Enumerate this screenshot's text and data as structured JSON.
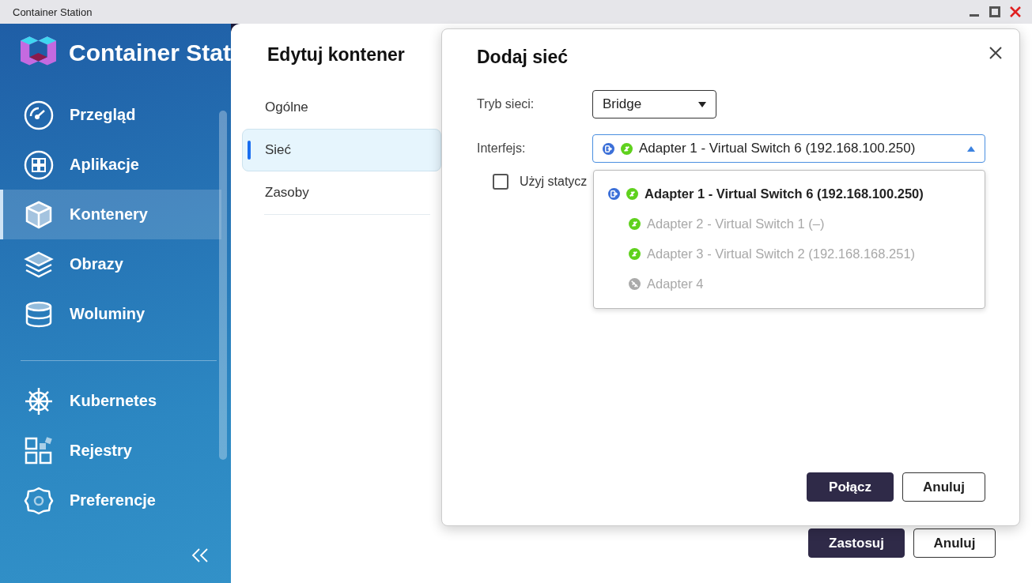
{
  "window": {
    "title": "Container Station"
  },
  "sidebar": {
    "title": "Container Stat",
    "groups": [
      [
        {
          "label": "Przegląd",
          "selected": false
        },
        {
          "label": "Aplikacje",
          "selected": false
        },
        {
          "label": "Kontenery",
          "selected": true
        },
        {
          "label": "Obrazy",
          "selected": false
        },
        {
          "label": "Woluminy",
          "selected": false
        }
      ],
      [
        {
          "label": "Kubernetes",
          "selected": false
        },
        {
          "label": "Rejestry",
          "selected": false
        },
        {
          "label": "Preferencje",
          "selected": false
        }
      ]
    ]
  },
  "editor": {
    "title": "Edytuj kontener",
    "nav": [
      {
        "label": "Ogólne",
        "selected": false
      },
      {
        "label": "Sieć",
        "selected": true
      },
      {
        "label": "Zasoby",
        "selected": false
      }
    ],
    "buttons": [
      {
        "label": "Zastosuj",
        "kind": "primary"
      },
      {
        "label": "Anuluj",
        "kind": "secondary"
      }
    ]
  },
  "dialog": {
    "title": "Dodaj sieć",
    "network_mode": {
      "label": "Tryb sieci:",
      "value": "Bridge"
    },
    "interface": {
      "label": "Interfejs:",
      "value": "Adapter 1 - Virtual Switch 6 (192.168.100.250)",
      "expanded": true,
      "options": [
        {
          "label": "Adapter 1 - Virtual Switch 6 (192.168.100.250)",
          "selected": true,
          "disabled": false,
          "bridge": true,
          "connected": true
        },
        {
          "label": "Adapter 2 - Virtual Switch 1 (–)",
          "selected": false,
          "disabled": true,
          "bridge": false,
          "connected": true
        },
        {
          "label": "Adapter 3 - Virtual Switch 2 (192.168.168.251)",
          "selected": false,
          "disabled": true,
          "bridge": false,
          "connected": true
        },
        {
          "label": "Adapter 4",
          "selected": false,
          "disabled": true,
          "bridge": false,
          "connected": false
        }
      ]
    },
    "checkbox": {
      "label": "Użyj statycz",
      "checked": false
    },
    "buttons": [
      {
        "label": "Połącz",
        "kind": "primary"
      },
      {
        "label": "Anuluj",
        "kind": "secondary"
      }
    ]
  }
}
